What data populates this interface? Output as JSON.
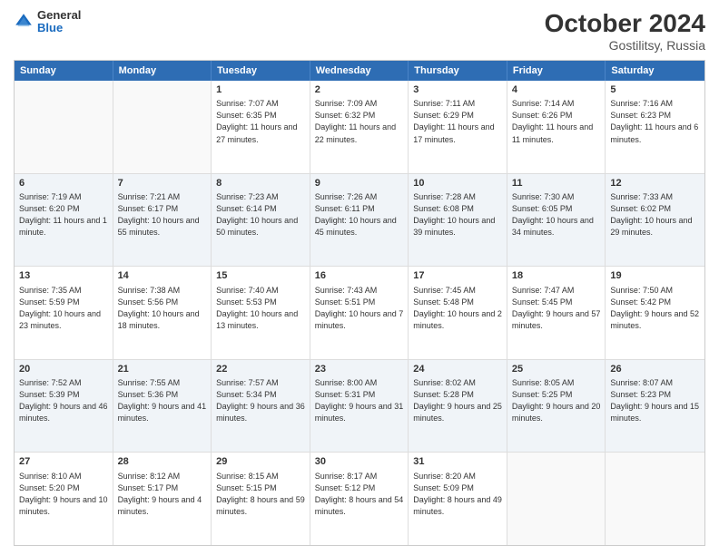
{
  "header": {
    "logo": {
      "line1": "General",
      "line2": "Blue"
    },
    "title": "October 2024",
    "location": "Gostilitsy, Russia"
  },
  "days_of_week": [
    "Sunday",
    "Monday",
    "Tuesday",
    "Wednesday",
    "Thursday",
    "Friday",
    "Saturday"
  ],
  "weeks": [
    {
      "cells": [
        {
          "day": "",
          "empty": true
        },
        {
          "day": "",
          "empty": true
        },
        {
          "day": "1",
          "sunrise": "Sunrise: 7:07 AM",
          "sunset": "Sunset: 6:35 PM",
          "daylight": "Daylight: 11 hours and 27 minutes."
        },
        {
          "day": "2",
          "sunrise": "Sunrise: 7:09 AM",
          "sunset": "Sunset: 6:32 PM",
          "daylight": "Daylight: 11 hours and 22 minutes."
        },
        {
          "day": "3",
          "sunrise": "Sunrise: 7:11 AM",
          "sunset": "Sunset: 6:29 PM",
          "daylight": "Daylight: 11 hours and 17 minutes."
        },
        {
          "day": "4",
          "sunrise": "Sunrise: 7:14 AM",
          "sunset": "Sunset: 6:26 PM",
          "daylight": "Daylight: 11 hours and 11 minutes."
        },
        {
          "day": "5",
          "sunrise": "Sunrise: 7:16 AM",
          "sunset": "Sunset: 6:23 PM",
          "daylight": "Daylight: 11 hours and 6 minutes."
        }
      ]
    },
    {
      "cells": [
        {
          "day": "6",
          "sunrise": "Sunrise: 7:19 AM",
          "sunset": "Sunset: 6:20 PM",
          "daylight": "Daylight: 11 hours and 1 minute."
        },
        {
          "day": "7",
          "sunrise": "Sunrise: 7:21 AM",
          "sunset": "Sunset: 6:17 PM",
          "daylight": "Daylight: 10 hours and 55 minutes."
        },
        {
          "day": "8",
          "sunrise": "Sunrise: 7:23 AM",
          "sunset": "Sunset: 6:14 PM",
          "daylight": "Daylight: 10 hours and 50 minutes."
        },
        {
          "day": "9",
          "sunrise": "Sunrise: 7:26 AM",
          "sunset": "Sunset: 6:11 PM",
          "daylight": "Daylight: 10 hours and 45 minutes."
        },
        {
          "day": "10",
          "sunrise": "Sunrise: 7:28 AM",
          "sunset": "Sunset: 6:08 PM",
          "daylight": "Daylight: 10 hours and 39 minutes."
        },
        {
          "day": "11",
          "sunrise": "Sunrise: 7:30 AM",
          "sunset": "Sunset: 6:05 PM",
          "daylight": "Daylight: 10 hours and 34 minutes."
        },
        {
          "day": "12",
          "sunrise": "Sunrise: 7:33 AM",
          "sunset": "Sunset: 6:02 PM",
          "daylight": "Daylight: 10 hours and 29 minutes."
        }
      ]
    },
    {
      "cells": [
        {
          "day": "13",
          "sunrise": "Sunrise: 7:35 AM",
          "sunset": "Sunset: 5:59 PM",
          "daylight": "Daylight: 10 hours and 23 minutes."
        },
        {
          "day": "14",
          "sunrise": "Sunrise: 7:38 AM",
          "sunset": "Sunset: 5:56 PM",
          "daylight": "Daylight: 10 hours and 18 minutes."
        },
        {
          "day": "15",
          "sunrise": "Sunrise: 7:40 AM",
          "sunset": "Sunset: 5:53 PM",
          "daylight": "Daylight: 10 hours and 13 minutes."
        },
        {
          "day": "16",
          "sunrise": "Sunrise: 7:43 AM",
          "sunset": "Sunset: 5:51 PM",
          "daylight": "Daylight: 10 hours and 7 minutes."
        },
        {
          "day": "17",
          "sunrise": "Sunrise: 7:45 AM",
          "sunset": "Sunset: 5:48 PM",
          "daylight": "Daylight: 10 hours and 2 minutes."
        },
        {
          "day": "18",
          "sunrise": "Sunrise: 7:47 AM",
          "sunset": "Sunset: 5:45 PM",
          "daylight": "Daylight: 9 hours and 57 minutes."
        },
        {
          "day": "19",
          "sunrise": "Sunrise: 7:50 AM",
          "sunset": "Sunset: 5:42 PM",
          "daylight": "Daylight: 9 hours and 52 minutes."
        }
      ]
    },
    {
      "cells": [
        {
          "day": "20",
          "sunrise": "Sunrise: 7:52 AM",
          "sunset": "Sunset: 5:39 PM",
          "daylight": "Daylight: 9 hours and 46 minutes."
        },
        {
          "day": "21",
          "sunrise": "Sunrise: 7:55 AM",
          "sunset": "Sunset: 5:36 PM",
          "daylight": "Daylight: 9 hours and 41 minutes."
        },
        {
          "day": "22",
          "sunrise": "Sunrise: 7:57 AM",
          "sunset": "Sunset: 5:34 PM",
          "daylight": "Daylight: 9 hours and 36 minutes."
        },
        {
          "day": "23",
          "sunrise": "Sunrise: 8:00 AM",
          "sunset": "Sunset: 5:31 PM",
          "daylight": "Daylight: 9 hours and 31 minutes."
        },
        {
          "day": "24",
          "sunrise": "Sunrise: 8:02 AM",
          "sunset": "Sunset: 5:28 PM",
          "daylight": "Daylight: 9 hours and 25 minutes."
        },
        {
          "day": "25",
          "sunrise": "Sunrise: 8:05 AM",
          "sunset": "Sunset: 5:25 PM",
          "daylight": "Daylight: 9 hours and 20 minutes."
        },
        {
          "day": "26",
          "sunrise": "Sunrise: 8:07 AM",
          "sunset": "Sunset: 5:23 PM",
          "daylight": "Daylight: 9 hours and 15 minutes."
        }
      ]
    },
    {
      "cells": [
        {
          "day": "27",
          "sunrise": "Sunrise: 8:10 AM",
          "sunset": "Sunset: 5:20 PM",
          "daylight": "Daylight: 9 hours and 10 minutes."
        },
        {
          "day": "28",
          "sunrise": "Sunrise: 8:12 AM",
          "sunset": "Sunset: 5:17 PM",
          "daylight": "Daylight: 9 hours and 4 minutes."
        },
        {
          "day": "29",
          "sunrise": "Sunrise: 8:15 AM",
          "sunset": "Sunset: 5:15 PM",
          "daylight": "Daylight: 8 hours and 59 minutes."
        },
        {
          "day": "30",
          "sunrise": "Sunrise: 8:17 AM",
          "sunset": "Sunset: 5:12 PM",
          "daylight": "Daylight: 8 hours and 54 minutes."
        },
        {
          "day": "31",
          "sunrise": "Sunrise: 8:20 AM",
          "sunset": "Sunset: 5:09 PM",
          "daylight": "Daylight: 8 hours and 49 minutes."
        },
        {
          "day": "",
          "empty": true
        },
        {
          "day": "",
          "empty": true
        }
      ]
    }
  ]
}
